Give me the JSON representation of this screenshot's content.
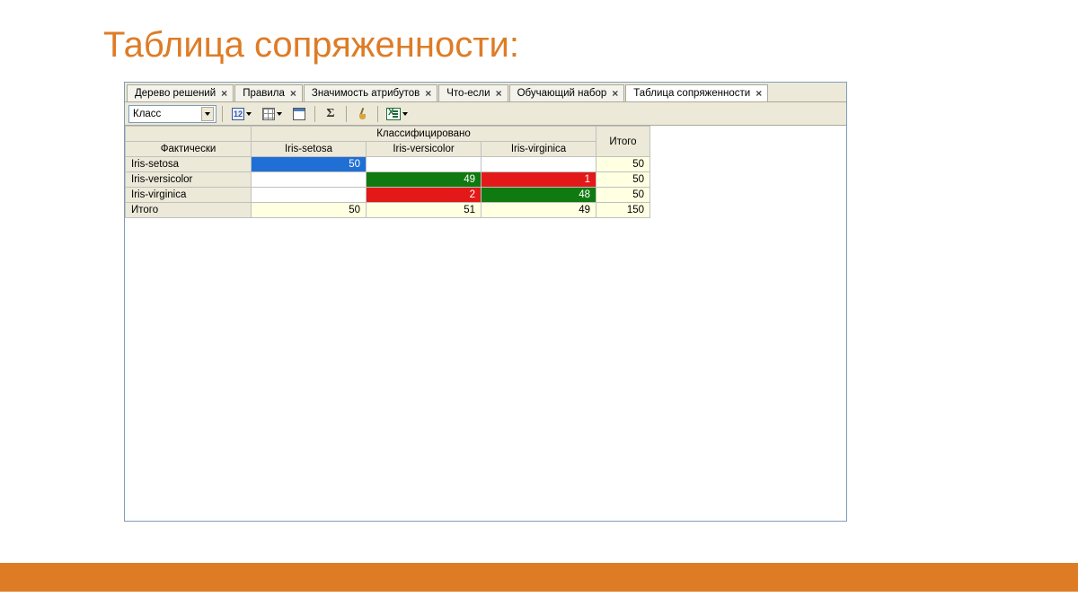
{
  "slide_title": "Таблица сопряженности:",
  "tabs": [
    {
      "label": "Дерево решений",
      "active": false
    },
    {
      "label": "Правила",
      "active": false
    },
    {
      "label": "Значимость атрибутов",
      "active": false
    },
    {
      "label": "Что-если",
      "active": false
    },
    {
      "label": "Обучающий набор",
      "active": false
    },
    {
      "label": "Таблица сопряженности",
      "active": true
    }
  ],
  "toolbar": {
    "combo_value": "Класс",
    "icons": [
      "12",
      "grid",
      "cal",
      "sigma",
      "brush",
      "excel"
    ]
  },
  "headers": {
    "super": "Классифицировано",
    "row_header": "Фактически",
    "cols": [
      "Iris-setosa",
      "Iris-versicolor",
      "Iris-virginica"
    ],
    "total": "Итого"
  },
  "rows": [
    {
      "label": "Iris-setosa",
      "cells": [
        {
          "v": "50",
          "c": "blue"
        },
        {
          "v": "",
          "c": ""
        },
        {
          "v": "",
          "c": ""
        }
      ],
      "total": "50"
    },
    {
      "label": "Iris-versicolor",
      "cells": [
        {
          "v": "",
          "c": ""
        },
        {
          "v": "49",
          "c": "green"
        },
        {
          "v": "1",
          "c": "red"
        }
      ],
      "total": "50"
    },
    {
      "label": "Iris-virginica",
      "cells": [
        {
          "v": "",
          "c": ""
        },
        {
          "v": "2",
          "c": "red"
        },
        {
          "v": "48",
          "c": "green"
        }
      ],
      "total": "50"
    }
  ],
  "totals_row": {
    "label": "Итого",
    "cells": [
      "50",
      "51",
      "49"
    ],
    "total": "150"
  }
}
